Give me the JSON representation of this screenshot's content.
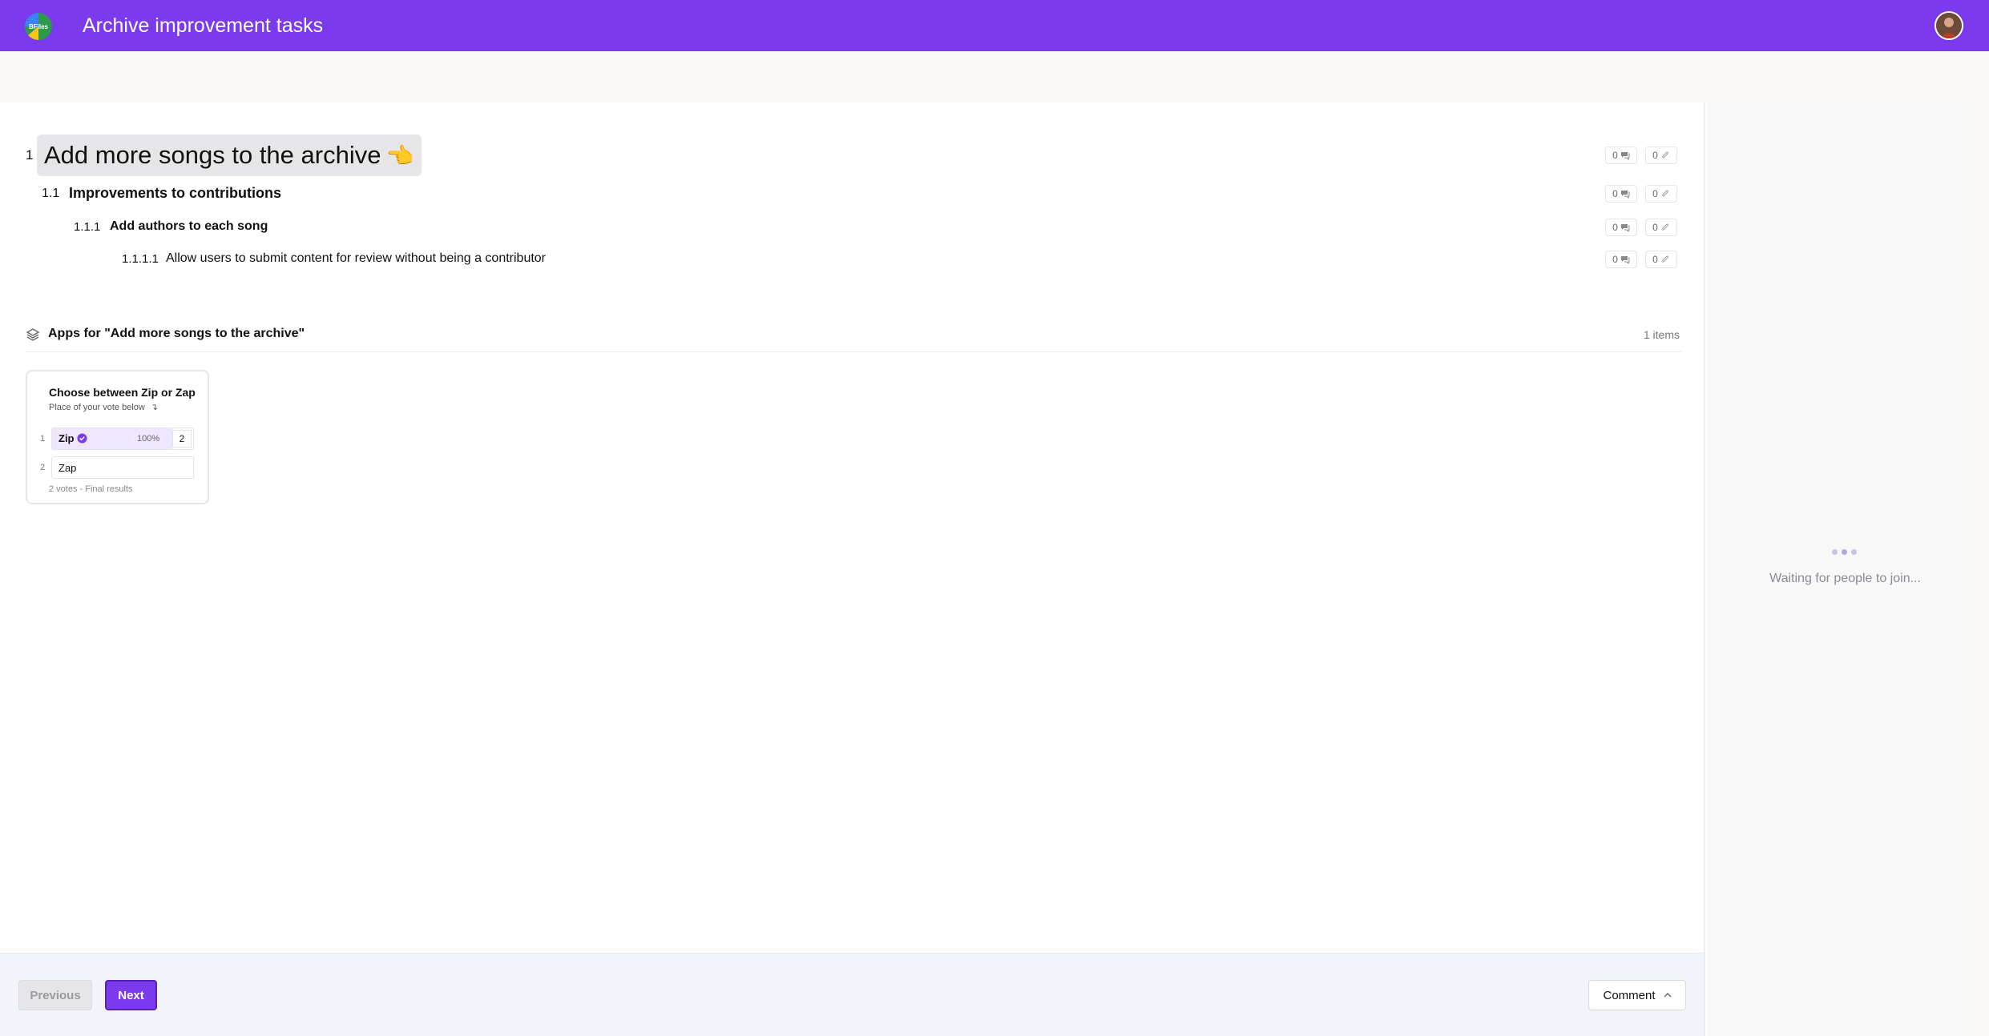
{
  "header": {
    "title": "Archive improvement tasks",
    "logo_text": "BFiles",
    "brand_color": "#7c3aed"
  },
  "outline": [
    {
      "number": "1",
      "text": "Add more songs to the archive",
      "comments": "0",
      "attachments": "0"
    },
    {
      "number": "1.1",
      "text": "Improvements to contributions",
      "comments": "0",
      "attachments": "0"
    },
    {
      "number": "1.1.1",
      "text": "Add authors to each song",
      "comments": "0",
      "attachments": "0"
    },
    {
      "number": "1.1.1.1",
      "text": "Allow users to submit content for review without being a contributor",
      "comments": "0",
      "attachments": "0"
    }
  ],
  "apps": {
    "title": "Apps for \"Add more songs to the archive\"",
    "count": "1 items",
    "poll": {
      "title": "Choose between Zip or Zap",
      "subtitle": "Place of your vote below",
      "options": [
        {
          "number": "1",
          "label": "Zip",
          "percent": "100%",
          "votes": "2",
          "winner": true,
          "fraction": 1.0
        },
        {
          "number": "2",
          "label": "Zap",
          "percent": "",
          "votes": "",
          "winner": false,
          "fraction": 0
        }
      ],
      "footer": "2 votes - Final results"
    }
  },
  "footer": {
    "previous_label": "Previous",
    "next_label": "Next",
    "comment_label": "Comment"
  },
  "sidepane": {
    "waiting_text": "Waiting for people to join..."
  }
}
